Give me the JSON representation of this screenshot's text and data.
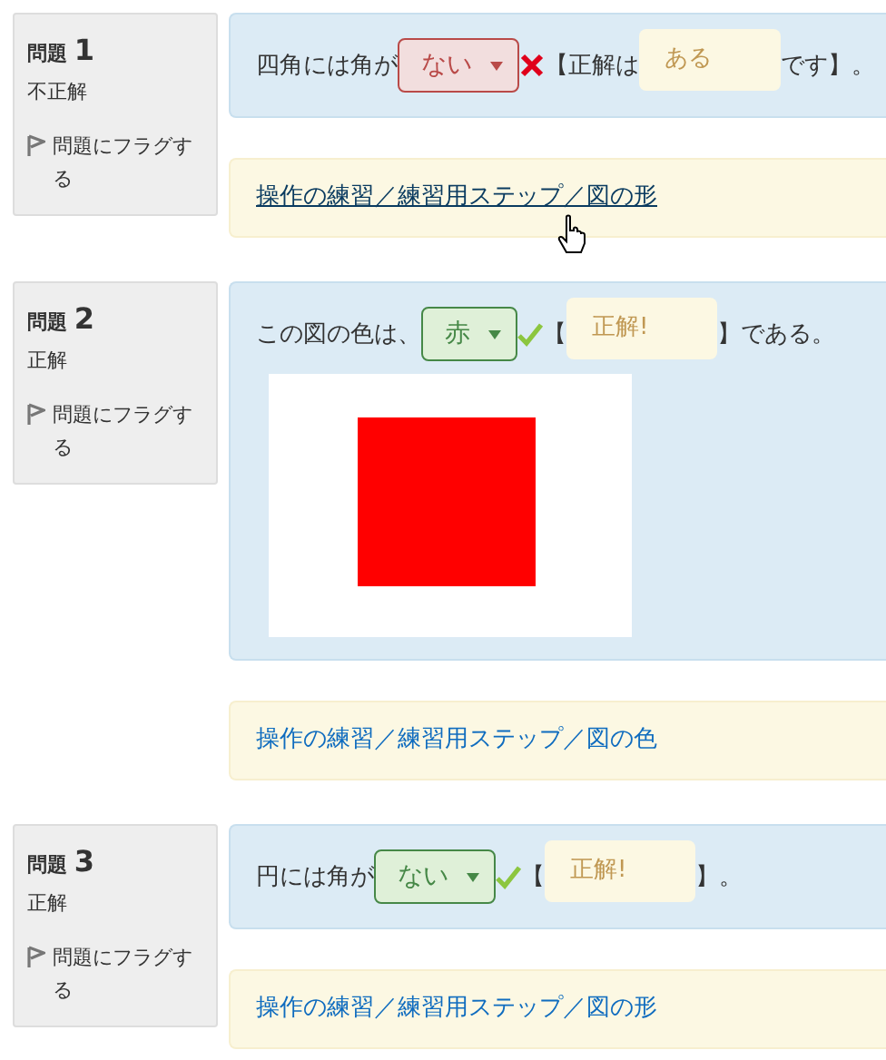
{
  "questions": [
    {
      "label": "問題",
      "number": "1",
      "status": "不正解",
      "flag": "問題にフラグする",
      "segments": [
        {
          "kind": "text",
          "text": "四角には角が"
        },
        {
          "kind": "select",
          "value": "ない",
          "correct": false
        },
        {
          "kind": "text",
          "text": "【正解は"
        },
        {
          "kind": "answer",
          "text": "ある"
        },
        {
          "kind": "text",
          "text": "です】。"
        }
      ],
      "feedback": {
        "link": "操作の練習／練習用ステップ／図の形",
        "hovered": true
      }
    },
    {
      "label": "問題",
      "number": "2",
      "status": "正解",
      "flag": "問題にフラグする",
      "segments": [
        {
          "kind": "text",
          "text": "この図の色は、"
        },
        {
          "kind": "select",
          "value": "赤",
          "correct": true
        },
        {
          "kind": "text",
          "text": "【"
        },
        {
          "kind": "answer",
          "text": "正解!"
        },
        {
          "kind": "text",
          "text": "】である。"
        }
      ],
      "feedback": {
        "link": "操作の練習／練習用ステップ／図の色",
        "hovered": false
      }
    },
    {
      "label": "問題",
      "number": "3",
      "status": "正解",
      "flag": "問題にフラグする",
      "segments": [
        {
          "kind": "text",
          "text": "円には角が"
        },
        {
          "kind": "select",
          "value": "ない",
          "correct": true
        },
        {
          "kind": "text",
          "text": "【"
        },
        {
          "kind": "answer",
          "text": "正解!"
        },
        {
          "kind": "text",
          "text": "】。"
        }
      ],
      "feedback": {
        "link": "操作の練習／練習用ステップ／図の形",
        "hovered": false
      }
    }
  ]
}
